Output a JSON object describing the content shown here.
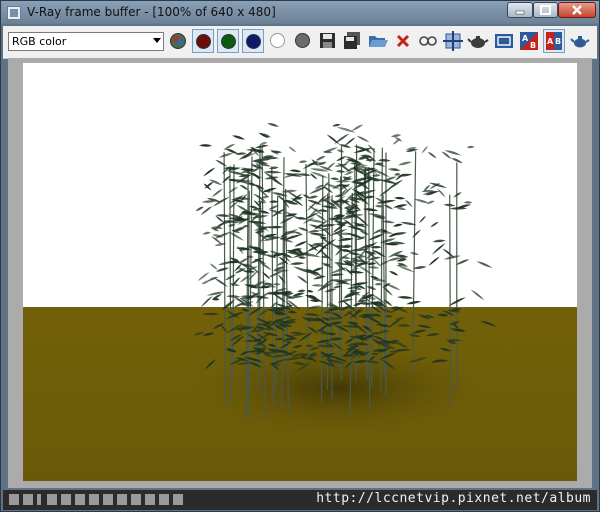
{
  "window": {
    "title": "V-Ray frame buffer - [100% of 640 x 480]"
  },
  "toolbar": {
    "channel": {
      "selected": "RGB color"
    },
    "colors": {
      "red": "#6b0e0e",
      "green": "#0b5a12",
      "blue": "#0c1a6e"
    }
  },
  "scene": {
    "sky_color": "#ffffff",
    "ground_color": "#6b5a08",
    "foliage_color": "#1f3524"
  },
  "watermark": {
    "text": "http://lccnetvip.pixnet.net/album"
  }
}
